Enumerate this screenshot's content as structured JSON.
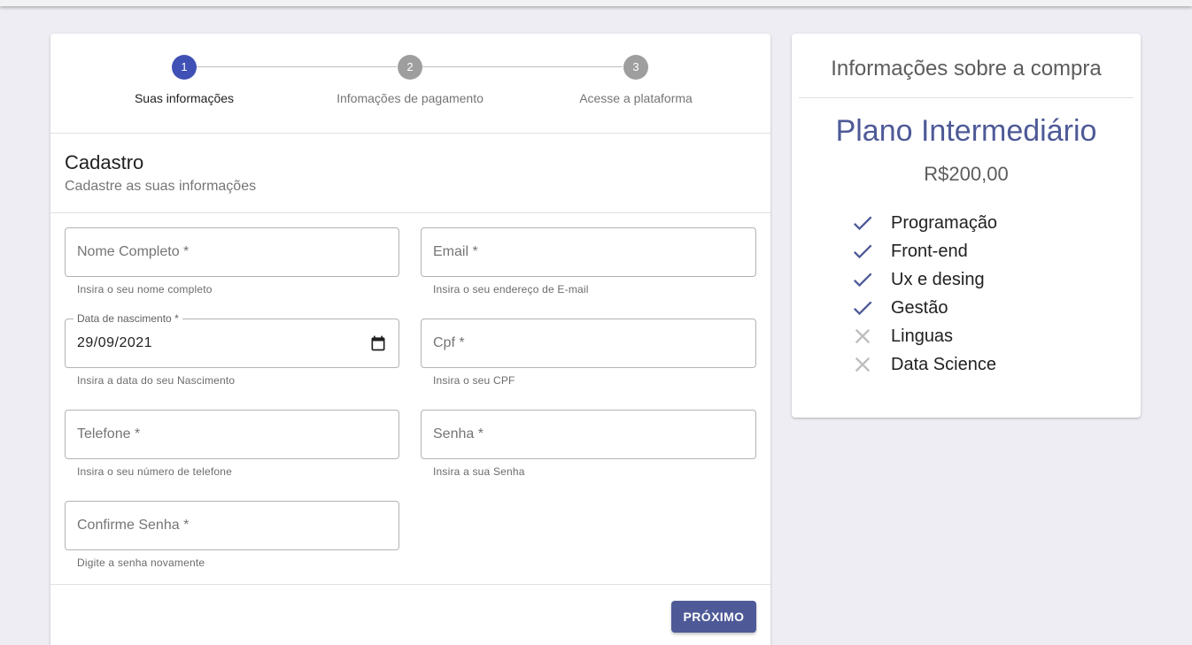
{
  "stepper": {
    "steps": [
      {
        "number": "1",
        "label": "Suas informações",
        "active": true
      },
      {
        "number": "2",
        "label": "Infomações de pagamento",
        "active": false
      },
      {
        "number": "3",
        "label": "Acesse a plataforma",
        "active": false
      }
    ]
  },
  "form": {
    "title": "Cadastro",
    "subtitle": "Cadastre as suas informações",
    "fields": {
      "nome": {
        "placeholder": "Nome Completo *",
        "helper": "Insira o seu nome completo"
      },
      "email": {
        "placeholder": "Email *",
        "helper": "Insira o seu endereço de E-mail"
      },
      "nascimento": {
        "label": "Data de nascimento *",
        "value": "29/09/2021",
        "helper": "Insira a data do seu Nascimento"
      },
      "cpf": {
        "placeholder": "Cpf *",
        "helper": "Insira o seu CPF"
      },
      "telefone": {
        "placeholder": "Telefone *",
        "helper": "Insira o seu número de telefone"
      },
      "senha": {
        "placeholder": "Senha *",
        "helper": "Insira a sua Senha"
      },
      "confirme": {
        "placeholder": "Confirme Senha *",
        "helper": "Digite a senha novamente"
      }
    },
    "next_label": "PRÓXIMO"
  },
  "info": {
    "title": "Informações sobre a compra",
    "plan_name": "Plano Intermediário",
    "price": "R$200,00",
    "features": [
      {
        "label": "Programação",
        "icon": "check-icon"
      },
      {
        "label": "Front-end",
        "icon": "check-icon"
      },
      {
        "label": "Ux e desing",
        "icon": "check-icon"
      },
      {
        "label": "Gestão",
        "icon": "check-icon"
      },
      {
        "label": "Linguas",
        "icon": "close-icon"
      },
      {
        "label": "Data Science",
        "icon": "close-icon"
      }
    ]
  },
  "colors": {
    "primary": "#3f51b5",
    "accent": "#4e5a97",
    "inactive": "#9e9e9e",
    "excluded": "#bdbdbd"
  }
}
